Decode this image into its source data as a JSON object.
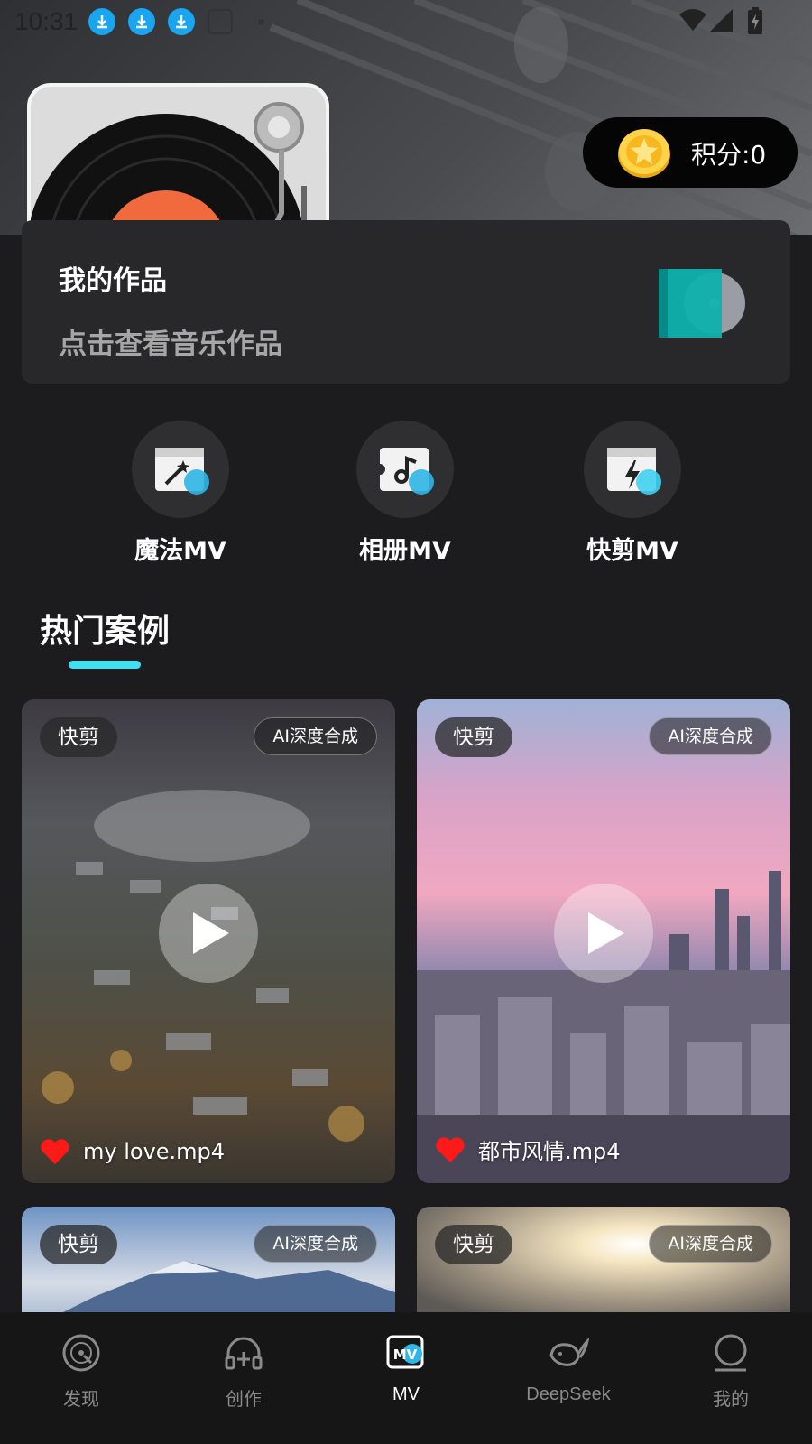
{
  "status_bar": {
    "time": "10:31"
  },
  "header": {
    "points_label": "积分:0"
  },
  "works": {
    "title": "我的作品",
    "subtitle": "点击查看音乐作品"
  },
  "features": [
    {
      "label": "魔法MV",
      "icon": "magic-wand-icon"
    },
    {
      "label": "相册MV",
      "icon": "music-note-icon"
    },
    {
      "label": "快剪MV",
      "icon": "lightning-icon"
    }
  ],
  "section": {
    "title": "热门案例"
  },
  "cases": [
    {
      "tag": "快剪",
      "badge": "AI深度合成",
      "name": "my love.mp4"
    },
    {
      "tag": "快剪",
      "badge": "AI深度合成",
      "name": "都市风情.mp4"
    },
    {
      "tag": "快剪",
      "badge": "AI深度合成"
    },
    {
      "tag": "快剪",
      "badge": "AI深度合成"
    }
  ],
  "nav": [
    {
      "label": "发现",
      "icon": "disc-icon",
      "active": false
    },
    {
      "label": "创作",
      "icon": "headphones-icon",
      "active": false
    },
    {
      "label": "MV",
      "icon": "mv-icon",
      "active": true
    },
    {
      "label": "DeepSeek",
      "icon": "whale-icon",
      "active": false
    },
    {
      "label": "我的",
      "icon": "profile-icon",
      "active": false
    }
  ],
  "colors": {
    "accent": "#3fe0f0",
    "background": "#1c1c1e",
    "card": "#28282a",
    "heart": "#ff1a1a"
  }
}
